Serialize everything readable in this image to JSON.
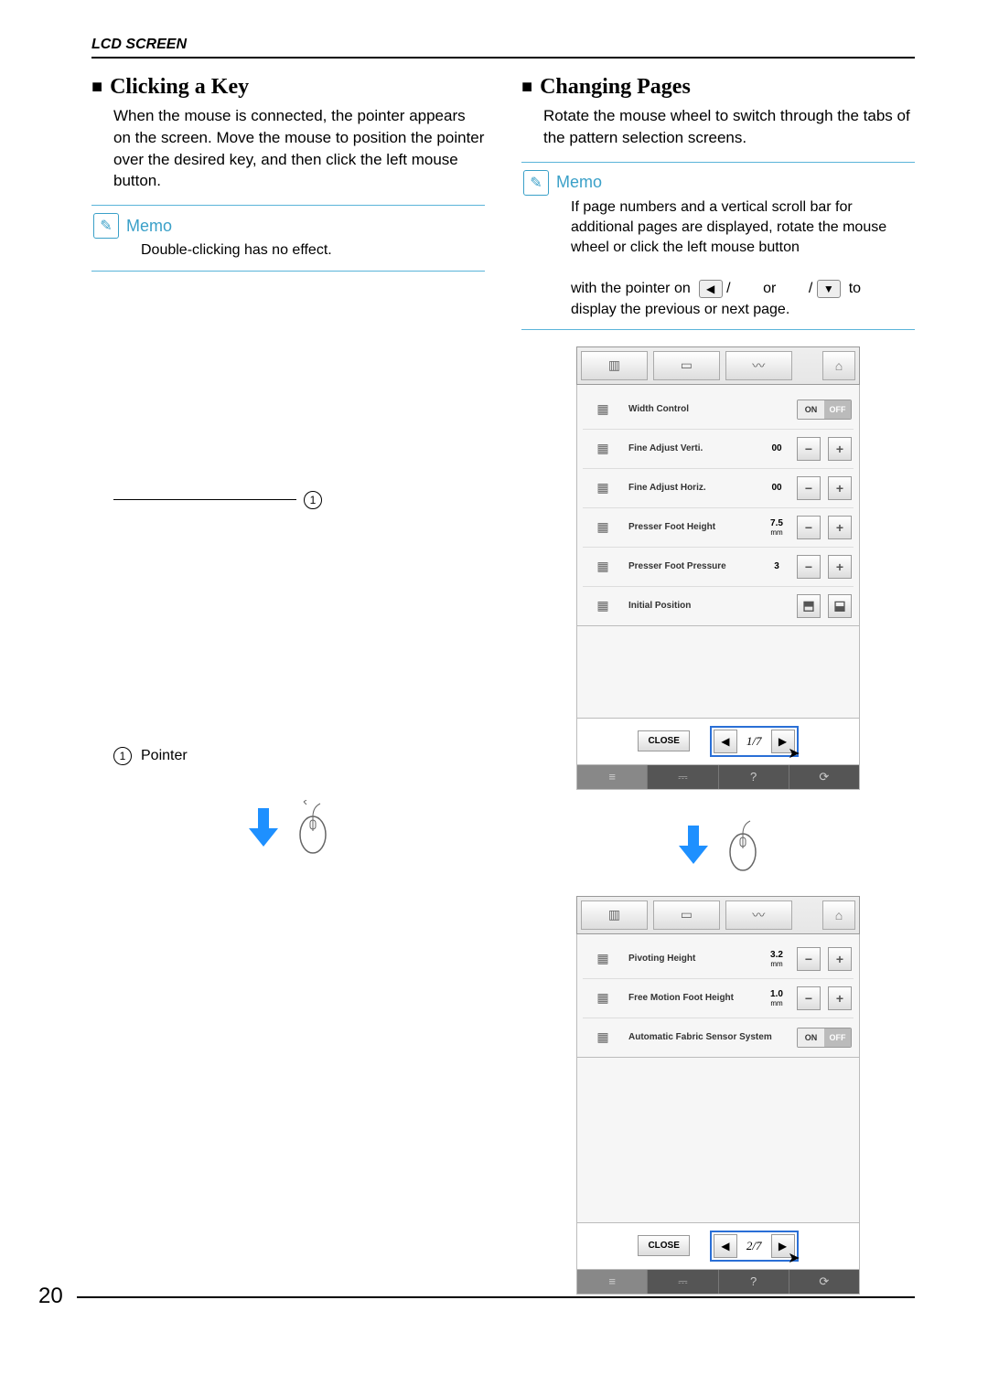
{
  "header": "LCD SCREEN",
  "page_number": "20",
  "left": {
    "title": "Clicking a Key",
    "body": "When the mouse is connected, the pointer appears on the screen. Move the mouse to position the pointer over the desired key, and then click the left mouse button.",
    "memo_label": "Memo",
    "memo_text": "Double-clicking has no effect.",
    "callout_num": "1",
    "pointer_legend_num": "1",
    "pointer_legend_text": "Pointer"
  },
  "right": {
    "title": "Changing Pages",
    "body": "Rotate the mouse wheel to switch through the tabs of the pattern selection screens.",
    "memo_label": "Memo",
    "memo_text1": "If page numbers and a vertical scroll bar for additional pages are displayed, rotate the mouse wheel or click the left mouse button",
    "memo_text2a": "with the pointer on",
    "memo_sep1": "/",
    "memo_or": "or",
    "memo_sep2": "/",
    "memo_to": "to",
    "memo_text3": "display the previous or next page."
  },
  "lcd1": {
    "rows": [
      {
        "label": "Width Control",
        "value": "",
        "unit": "",
        "toggle": true,
        "on": "ON",
        "off": "OFF"
      },
      {
        "label": "Fine Adjust Verti.",
        "value": "00",
        "unit": ""
      },
      {
        "label": "Fine Adjust Horiz.",
        "value": "00",
        "unit": ""
      },
      {
        "label": "Presser Foot Height",
        "value": "7.5",
        "unit": "mm"
      },
      {
        "label": "Presser Foot Pressure",
        "value": "3",
        "unit": ""
      },
      {
        "label": "Initial Position",
        "value": "",
        "unit": "",
        "dual": true
      }
    ],
    "close": "CLOSE",
    "page": "1/7"
  },
  "lcd2": {
    "rows": [
      {
        "label": "Pivoting Height",
        "value": "3.2",
        "unit": "mm"
      },
      {
        "label": "Free Motion Foot Height",
        "value": "1.0",
        "unit": "mm"
      },
      {
        "label": "Automatic Fabric Sensor System",
        "value": "",
        "unit": "",
        "toggle": true,
        "on": "ON",
        "off": "OFF"
      }
    ],
    "close": "CLOSE",
    "page": "2/7"
  }
}
